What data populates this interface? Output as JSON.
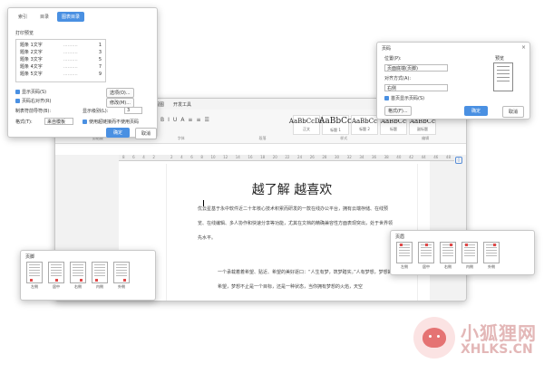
{
  "toc_dialog": {
    "tabs": [
      "索引",
      "目录",
      "图表目录"
    ],
    "preview_label": "打印预览",
    "entries": [
      {
        "label": "题条 1文字",
        "page": "1"
      },
      {
        "label": "题条 2文字",
        "page": "3"
      },
      {
        "label": "题条 3文字",
        "page": "5"
      },
      {
        "label": "题条 4文字",
        "page": "7"
      },
      {
        "label": "题条 5文字",
        "page": "9"
      }
    ],
    "show_page_numbers": "显示页码(S)",
    "right_align": "页码右对齐(R)",
    "tab_leader_label": "制表符前导符(B):",
    "format_label": "格式(T):",
    "format_value": "来自模板",
    "show_levels_label": "显示级别(L):",
    "levels_value": "3",
    "options_btn": "选项(O)...",
    "modify_btn": "修改(M)...",
    "hyperlink_label": "使用超链接而不使用页码",
    "ok": "确定",
    "cancel": "取消"
  },
  "word_window": {
    "menu": [
      "视图",
      "开发工具"
    ],
    "styles": [
      {
        "sample": "AaBbCcDd",
        "name": "正文"
      },
      {
        "sample": "AaBbCc",
        "name": "标题 1"
      },
      {
        "sample": "AaBbCc",
        "name": "标题 2"
      },
      {
        "sample": "AaBbCc",
        "name": "标题"
      },
      {
        "sample": "AaBbCc",
        "name": "副标题"
      }
    ],
    "groups": [
      "剪贴板",
      "字体",
      "段落",
      "样式",
      "编辑"
    ],
    "ruler": [
      "8",
      "6",
      "4",
      "2",
      "",
      "2",
      "4",
      "6",
      "8",
      "10",
      "12",
      "14",
      "16",
      "18",
      "20",
      "22",
      "24",
      "26",
      "28",
      "30",
      "32",
      "34",
      "36",
      "38",
      "40",
      "42",
      "44",
      "46",
      "48"
    ],
    "doc_title": "越了解 越喜欢",
    "para1": "优云星基于永中软件近二十年核心技术积累而研发的一款在线办公平台，拥有云端存储、在线预览、在线编辑、多人协作和快速分享等功能，尤其在文档的精确兼容性方面表现突出，处于世界领先水平。",
    "para2": "一个承载着着希望、贴近、希望的美好逐口：“人生有梦，筑梦踏实。”人有梦想，梦想的希望，梦想不止是一个目标，还是一种状态，当你拥有梦想的火焰，天空"
  },
  "page_number_dialog": {
    "title": "页码",
    "position_label": "位置(P):",
    "position_value": "页面底端(页脚)",
    "align_label": "对齐方式(A):",
    "align_value": "右侧",
    "first_page_label": "首页显示页码(S)",
    "preview_label": "预览",
    "format_btn": "格式(F)...",
    "ok": "确定",
    "cancel": "取消"
  },
  "footer_left": {
    "title": "页脚",
    "items": [
      "左侧",
      "居中",
      "右侧",
      "内侧",
      "外侧"
    ]
  },
  "footer_right": {
    "title": "页眉",
    "items": [
      "左侧",
      "居中",
      "右侧",
      "内侧",
      "外侧"
    ]
  },
  "watermark": {
    "cn": "小狐狸网",
    "en": "XHLKS.CN"
  }
}
